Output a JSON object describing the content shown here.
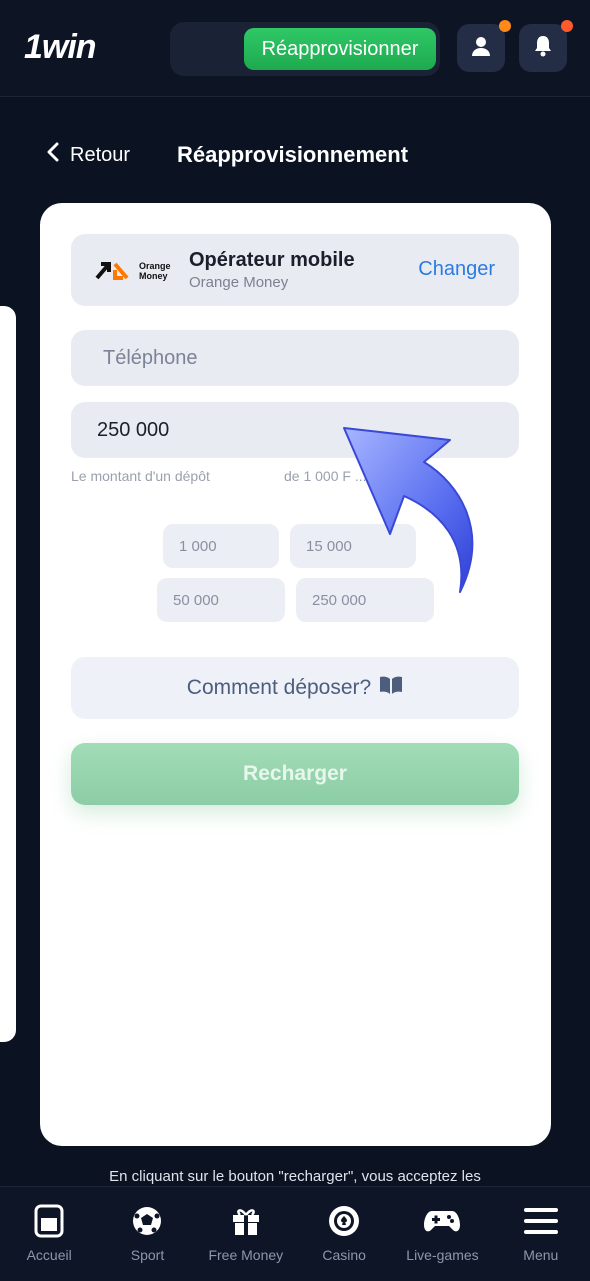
{
  "header": {
    "logo": "1win",
    "deposit_label": "Réapprovisionner",
    "profile_icon": "user-icon",
    "notifications_icon": "bell-icon",
    "badge_color": "#ff6a1a"
  },
  "subheader": {
    "back_label": "Retour",
    "title": "Réapprovisionnement"
  },
  "payment": {
    "operator_logo_text": "Orange Money",
    "operator_title": "Opérateur mobile",
    "operator_name": "Orange Money",
    "change_label": "Changer"
  },
  "form": {
    "phone_placeholder": "Téléphone",
    "amount_value": "250 000",
    "amount_hint": "Le montant d'un dépôt",
    "range_hint": "de 1 000 F ... 00"
  },
  "quick_amounts": [
    "1 000",
    "15 000",
    "50 000",
    "250 000"
  ],
  "how_to_label": "Comment déposer?",
  "recharge_label": "Recharger",
  "terms_text": "En cliquant sur le bouton \"recharger\", vous acceptez les",
  "bottom_nav": [
    {
      "label": "Accueil",
      "icon": "home-icon"
    },
    {
      "label": "Sport",
      "icon": "soccer-ball-icon"
    },
    {
      "label": "Free Money",
      "icon": "gift-icon"
    },
    {
      "label": "Casino",
      "icon": "casino-chip-icon"
    },
    {
      "label": "Live-games",
      "icon": "gamepad-icon"
    },
    {
      "label": "Menu",
      "icon": "menu-icon"
    }
  ],
  "colors": {
    "background": "#0b1222",
    "accent_green": "#1eaa4f",
    "link_blue": "#2a7be3",
    "arrow_blue": "#4f63ea"
  }
}
